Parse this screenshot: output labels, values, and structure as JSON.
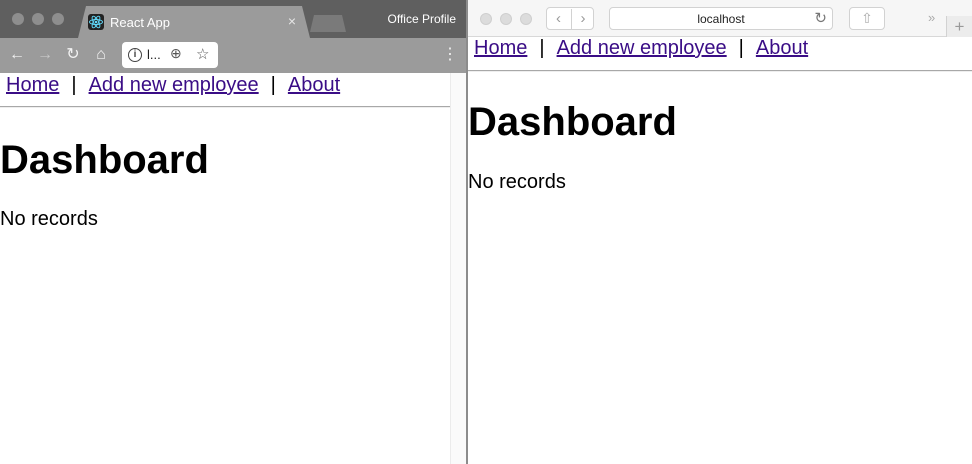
{
  "chrome": {
    "tab_title": "React App",
    "tab_close": "×",
    "profile": "Office Profile",
    "omnibox_text": "l...",
    "page": {
      "nav": [
        "Home",
        "Add new employee",
        "About"
      ],
      "separator": "|",
      "heading": "Dashboard",
      "message": "No records"
    }
  },
  "safari": {
    "address": "localhost",
    "page": {
      "nav": [
        "Home",
        "Add new employee",
        "About"
      ],
      "separator": "|",
      "heading": "Dashboard",
      "message": "No records"
    }
  },
  "colors": {
    "link": "#3a0d86",
    "chrome_tab_strip": "#5f5f5f",
    "chrome_toolbar": "#9b9b9b",
    "safari_toolbar": "#f6f6f6"
  }
}
